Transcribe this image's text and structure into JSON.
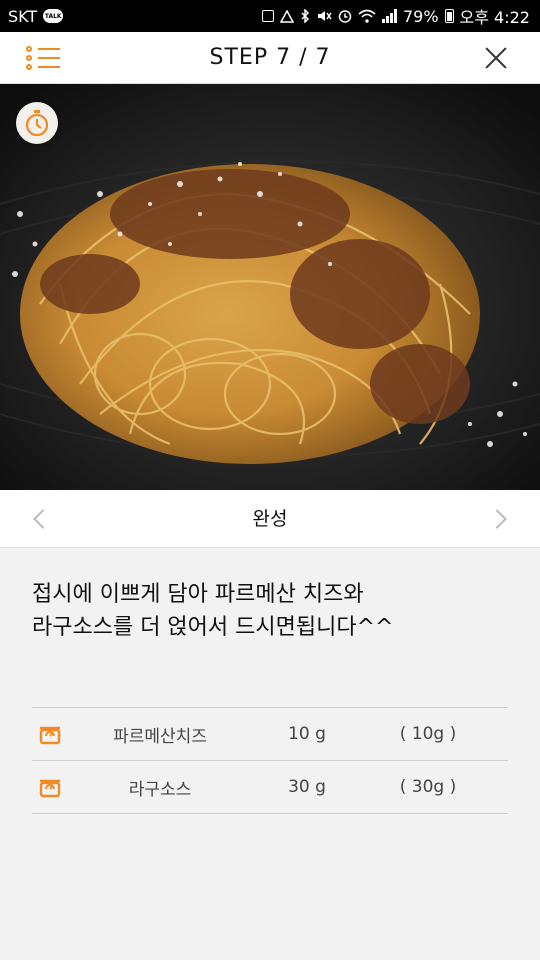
{
  "status_bar": {
    "carrier": "SKT",
    "talk_badge": "TALK",
    "battery": "79%",
    "time": "오후 4:22"
  },
  "header": {
    "title": "STEP  7 / 7"
  },
  "step_nav": {
    "label": "완성"
  },
  "description": {
    "line1": "접시에 이쁘게 담아 파르메산 치즈와",
    "line2": "라구소스를 더 얹어서 드시면됩니다^^"
  },
  "ingredients": [
    {
      "name": "파르메산치즈",
      "amount": "10 g",
      "alt": "( 10g )",
      "icon": "scale-icon"
    },
    {
      "name": "라구소스",
      "amount": "30 g",
      "alt": "( 30g )",
      "icon": "scale-icon"
    }
  ],
  "colors": {
    "accent": "#f08a24",
    "header_bg": "#ffffff",
    "page_bg": "#f2f2f2"
  }
}
